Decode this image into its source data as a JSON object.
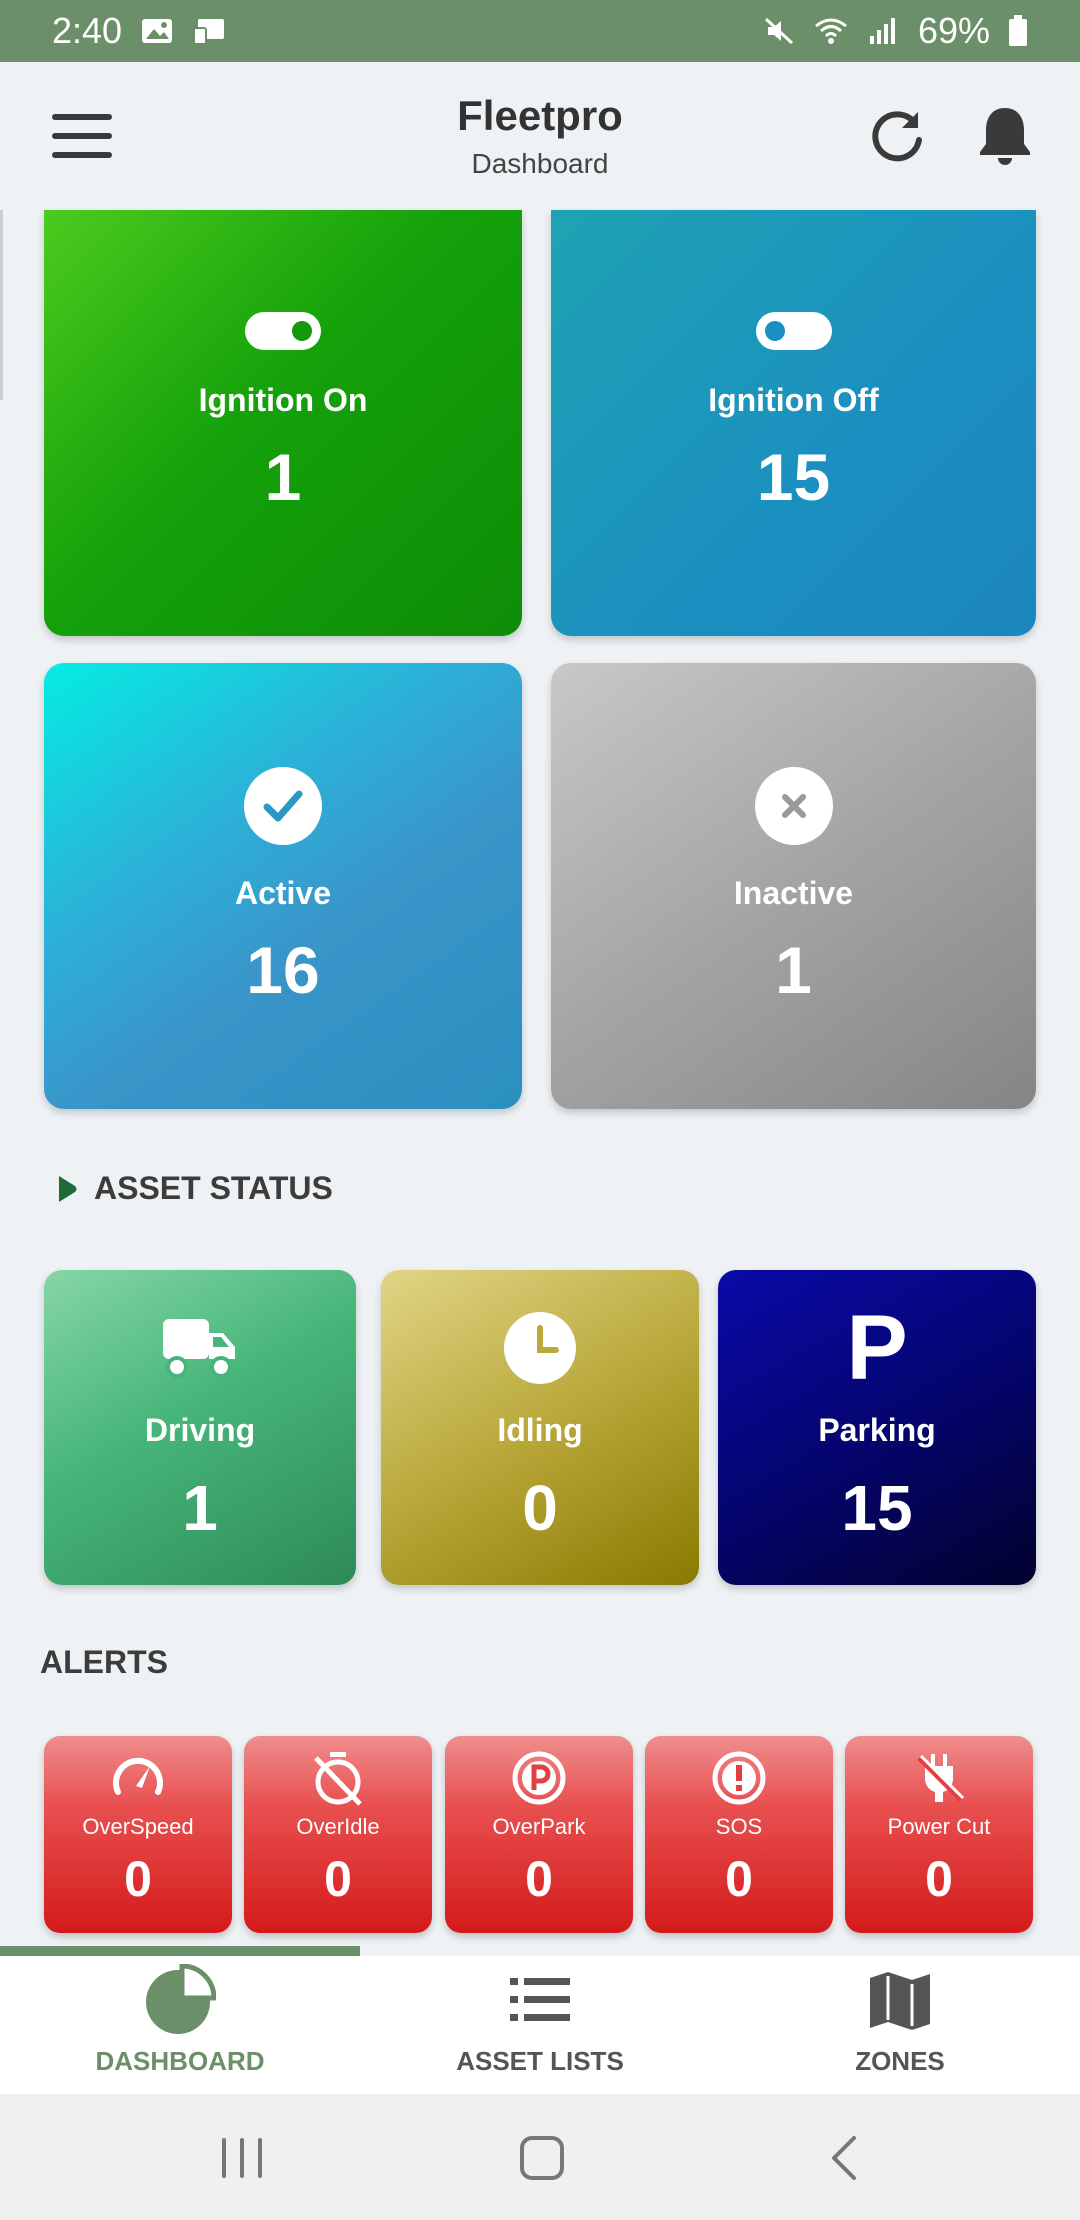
{
  "status_bar": {
    "time": "2:40",
    "battery": "69%"
  },
  "app_bar": {
    "title": "Fleetpro",
    "subtitle": "Dashboard"
  },
  "summary": {
    "ignition_on": {
      "label": "Ignition On",
      "value": "1"
    },
    "ignition_off": {
      "label": "Ignition Off",
      "value": "15"
    },
    "active": {
      "label": "Active",
      "value": "16"
    },
    "inactive": {
      "label": "Inactive",
      "value": "1"
    }
  },
  "asset_status": {
    "heading": "ASSET STATUS",
    "driving": {
      "label": "Driving",
      "value": "1"
    },
    "idling": {
      "label": "Idling",
      "value": "0"
    },
    "parking": {
      "label": "Parking",
      "value": "15",
      "icon_letter": "P"
    }
  },
  "alerts": {
    "heading": "ALERTS",
    "items": [
      {
        "label": "OverSpeed",
        "value": "0",
        "icon": "speedometer-icon"
      },
      {
        "label": "OverIdle",
        "value": "0",
        "icon": "timer-off-icon"
      },
      {
        "label": "OverPark",
        "value": "0",
        "icon": "parking-circle-icon"
      },
      {
        "label": "SOS",
        "value": "0",
        "icon": "alert-circle-icon"
      },
      {
        "label": "Power Cut",
        "value": "0",
        "icon": "power-plug-off-icon"
      }
    ]
  },
  "bottom_nav": {
    "items": [
      {
        "label": "DASHBOARD",
        "icon": "pie-chart-icon",
        "selected": true
      },
      {
        "label": "ASSET LISTS",
        "icon": "list-icon",
        "selected": false
      },
      {
        "label": "ZONES",
        "icon": "map-icon",
        "selected": false
      }
    ]
  },
  "colors": {
    "status_bar": "#6b8f68",
    "ignition_on": "#14a10a",
    "ignition_off": "#1b8fc0",
    "active": "#2bb2d8",
    "inactive": "#a4a4a4",
    "driving": "#46b57a",
    "idling": "#b9a83a",
    "parking": "#050570",
    "alert": "#d41a1a"
  }
}
